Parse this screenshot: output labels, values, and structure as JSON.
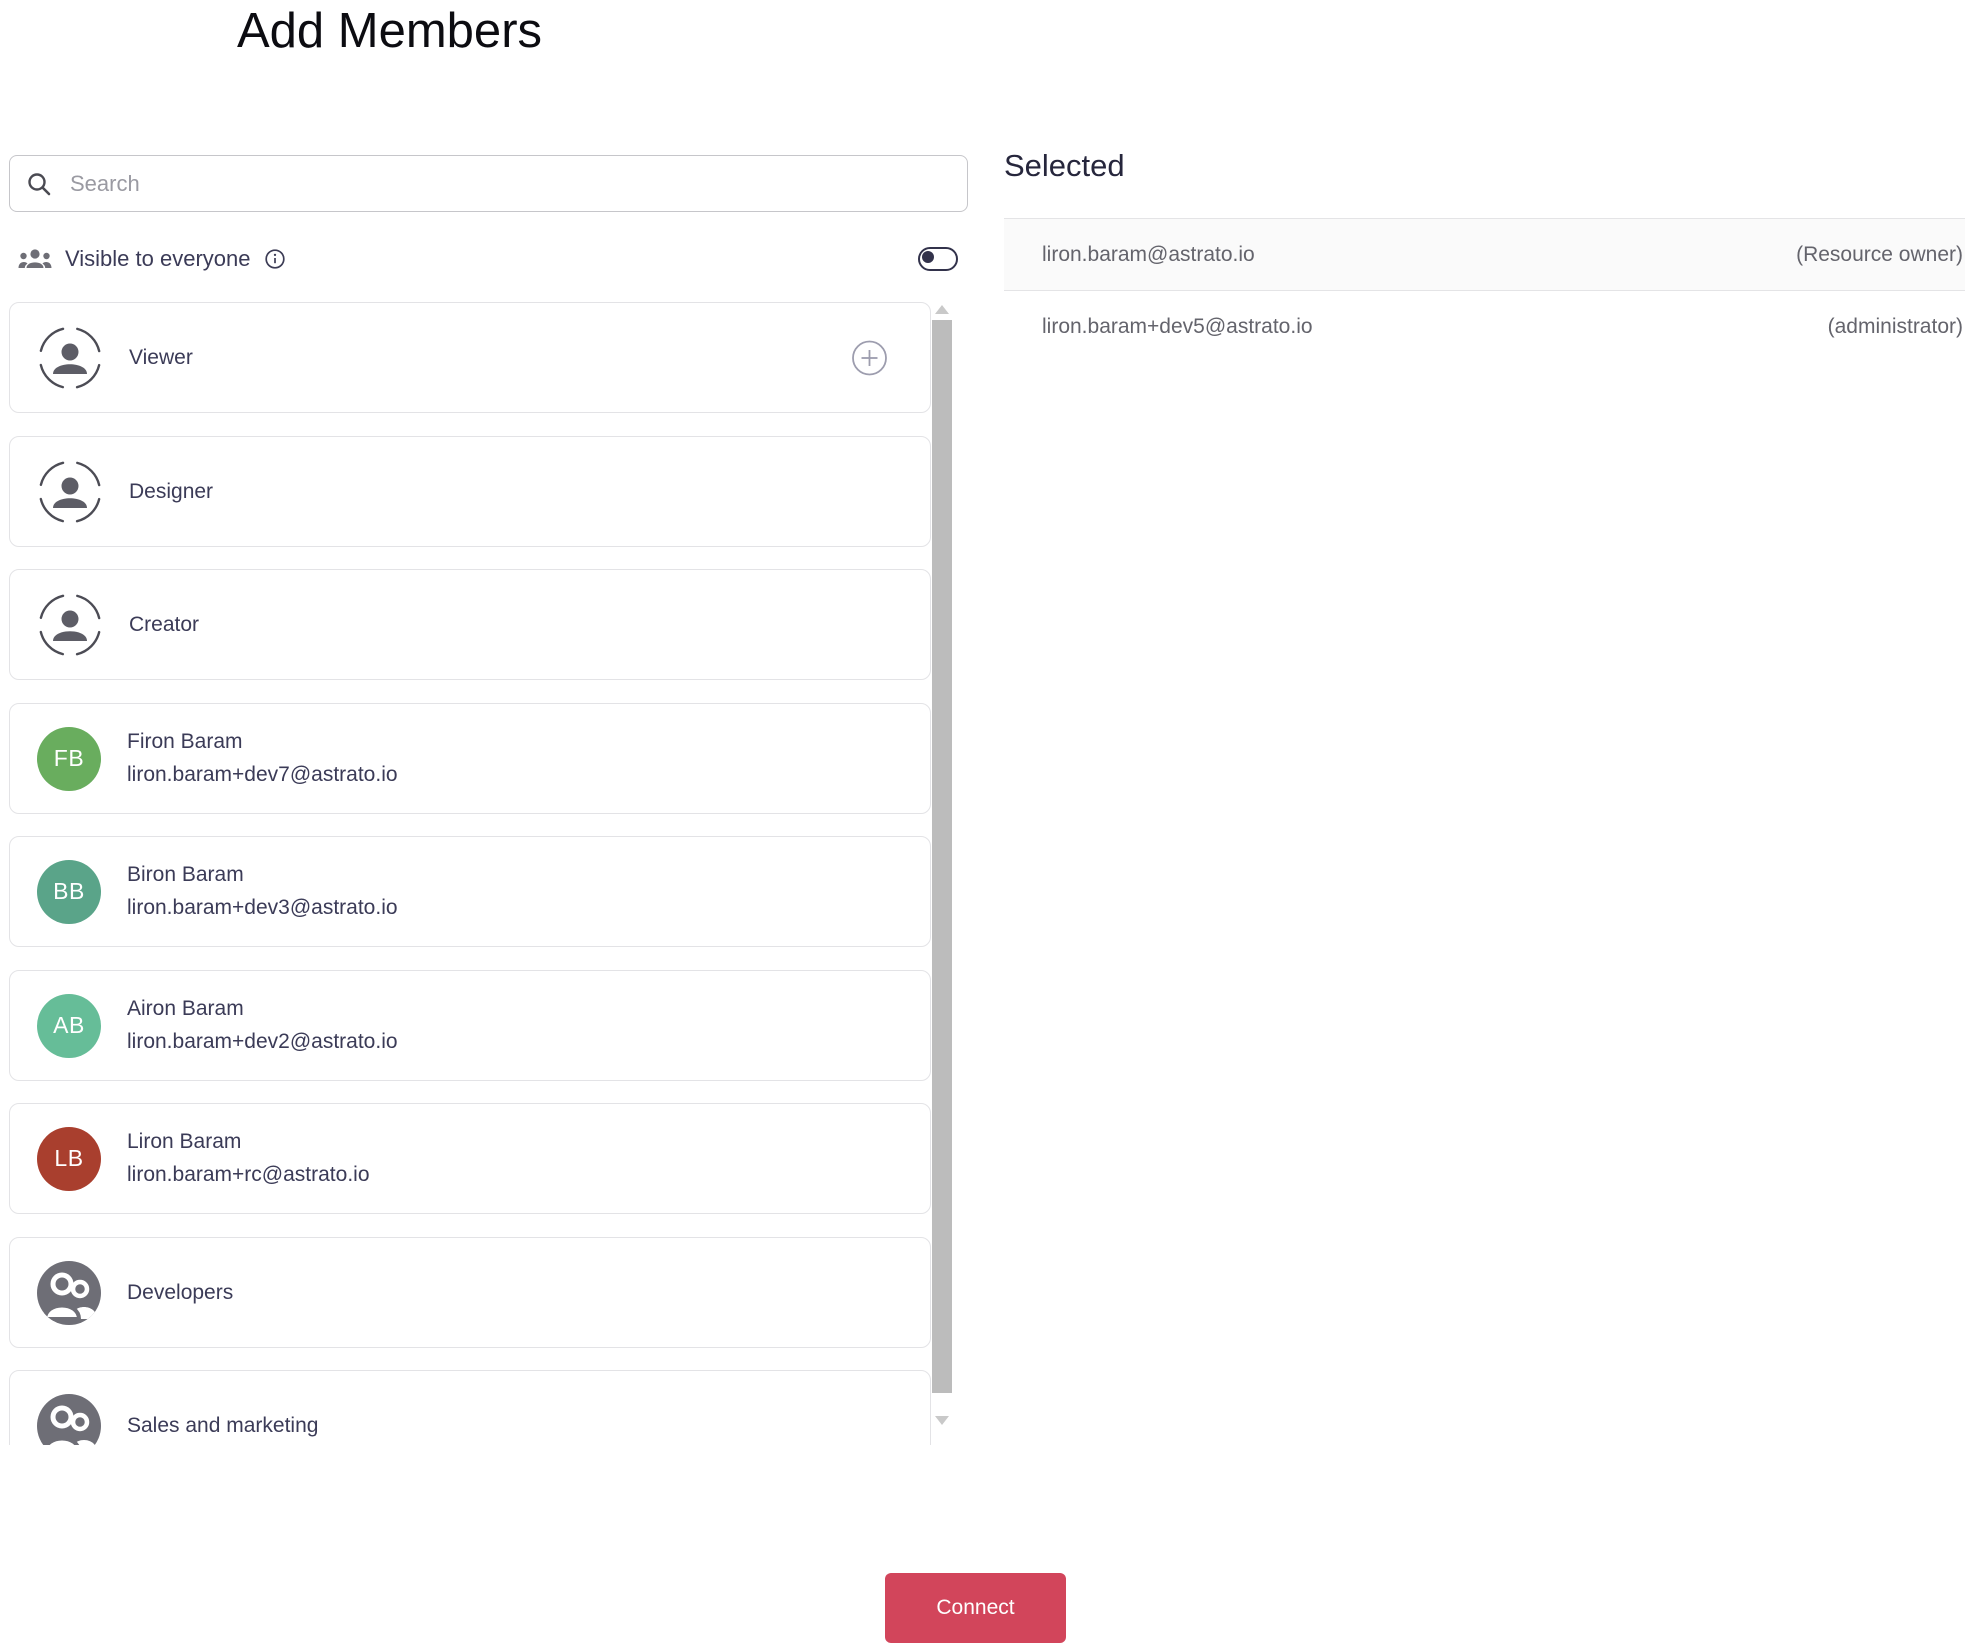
{
  "page": {
    "title": "Add Members"
  },
  "search": {
    "placeholder": "Search",
    "value": ""
  },
  "visibility": {
    "label": "Visible to everyone",
    "toggle_state": "off"
  },
  "list": {
    "items": [
      {
        "type": "role",
        "label": "Viewer",
        "has_add_button": true
      },
      {
        "type": "role",
        "label": "Designer"
      },
      {
        "type": "role",
        "label": "Creator"
      },
      {
        "type": "user",
        "initials": "FB",
        "name": "Firon Baram",
        "email": "liron.baram+dev7@astrato.io",
        "color": "#69ad5e"
      },
      {
        "type": "user",
        "initials": "BB",
        "name": "Biron Baram",
        "email": "liron.baram+dev3@astrato.io",
        "color": "#5aa489"
      },
      {
        "type": "user",
        "initials": "AB",
        "name": "Airon Baram",
        "email": "liron.baram+dev2@astrato.io",
        "color": "#66bd98"
      },
      {
        "type": "user",
        "initials": "LB",
        "name": "Liron Baram",
        "email": "liron.baram+rc@astrato.io",
        "color": "#a93f2e"
      },
      {
        "type": "group",
        "label": "Developers"
      },
      {
        "type": "group",
        "label": "Sales and marketing"
      }
    ]
  },
  "selected": {
    "title": "Selected",
    "rows": [
      {
        "email": "liron.baram@astrato.io",
        "role": "(Resource owner)"
      },
      {
        "email": "liron.baram+dev5@astrato.io",
        "role": "(administrator)"
      }
    ]
  },
  "footer": {
    "connect_label": "Connect"
  },
  "colors": {
    "accent": "#d2455b"
  }
}
